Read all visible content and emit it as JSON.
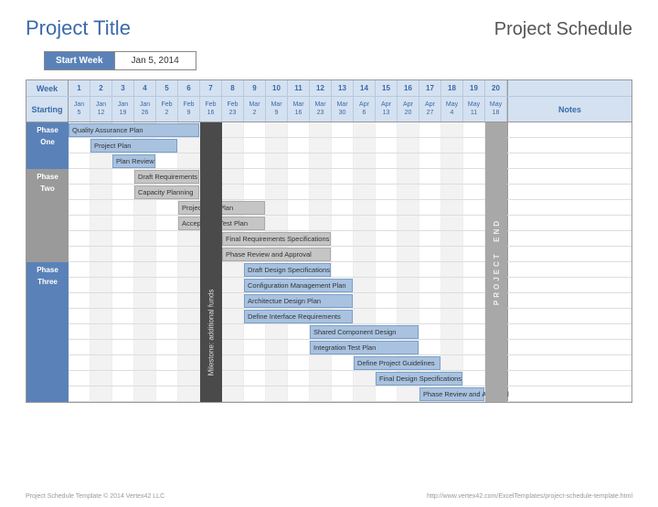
{
  "header": {
    "title": "Project Title",
    "schedule_label": "Project Schedule"
  },
  "start_week": {
    "label": "Start Week",
    "value": "Jan 5, 2014"
  },
  "columns": {
    "week_label": "Week",
    "starting_label": "Starting",
    "notes_label": "Notes",
    "weeks": [
      "1",
      "2",
      "3",
      "4",
      "5",
      "6",
      "7",
      "8",
      "9",
      "10",
      "11",
      "12",
      "13",
      "14",
      "15",
      "16",
      "17",
      "18",
      "19",
      "20"
    ],
    "dates": [
      [
        "Jan",
        "5"
      ],
      [
        "Jan",
        "12"
      ],
      [
        "Jan",
        "19"
      ],
      [
        "Jan",
        "26"
      ],
      [
        "Feb",
        "2"
      ],
      [
        "Feb",
        "9"
      ],
      [
        "Feb",
        "16"
      ],
      [
        "Feb",
        "23"
      ],
      [
        "Mar",
        "2"
      ],
      [
        "Mar",
        "9"
      ],
      [
        "Mar",
        "16"
      ],
      [
        "Mar",
        "23"
      ],
      [
        "Mar",
        "30"
      ],
      [
        "Apr",
        "6"
      ],
      [
        "Apr",
        "13"
      ],
      [
        "Apr",
        "20"
      ],
      [
        "Apr",
        "27"
      ],
      [
        "May",
        "4"
      ],
      [
        "May",
        "11"
      ],
      [
        "May",
        "18"
      ]
    ]
  },
  "phases": [
    {
      "name": "Phase One",
      "rows": [
        0,
        1,
        2
      ],
      "color": "#5a82b8"
    },
    {
      "name": "Phase Two",
      "rows": [
        3,
        4,
        5,
        6,
        7,
        8
      ],
      "color": "#9a9a9a"
    },
    {
      "name": "Phase Three",
      "rows": [
        9,
        10,
        11,
        12,
        13,
        14,
        15,
        16,
        17
      ],
      "color": "#5a82b8"
    }
  ],
  "milestone": {
    "column": 7,
    "label": "Milestone: additional funds",
    "from_row": 9,
    "to_row": 18
  },
  "project_end": {
    "column": 20,
    "label": "PROJECT END"
  },
  "chart_data": {
    "type": "gantt",
    "title": "Project Schedule",
    "x_unit": "week",
    "x_range": [
      1,
      20
    ],
    "tasks": [
      {
        "row": 0,
        "label": "Quality Assurance Plan",
        "start": 1,
        "duration": 6,
        "style": "blue"
      },
      {
        "row": 1,
        "label": "Project Plan",
        "start": 2,
        "duration": 4,
        "style": "blue"
      },
      {
        "row": 2,
        "label": "Plan Review",
        "start": 3,
        "duration": 2,
        "style": "blue"
      },
      {
        "row": 3,
        "label": "Draft Requirements",
        "start": 4,
        "duration": 3,
        "style": "gray"
      },
      {
        "row": 4,
        "label": "Capacity Planning",
        "start": 4,
        "duration": 3,
        "style": "gray"
      },
      {
        "row": 5,
        "label": "Project Test Plan",
        "start": 6,
        "duration": 4,
        "style": "gray"
      },
      {
        "row": 6,
        "label": "Acceptance Test Plan",
        "start": 6,
        "duration": 4,
        "style": "gray"
      },
      {
        "row": 7,
        "label": "Final Requirements Specifications",
        "start": 8,
        "duration": 5,
        "style": "gray"
      },
      {
        "row": 8,
        "label": "Phase Review and Approval",
        "start": 8,
        "duration": 5,
        "style": "gray"
      },
      {
        "row": 9,
        "label": "Draft Design Specifications",
        "start": 9,
        "duration": 4,
        "style": "blue"
      },
      {
        "row": 10,
        "label": "Configuration Management Plan",
        "start": 9,
        "duration": 5,
        "style": "blue"
      },
      {
        "row": 11,
        "label": "Architectue Design Plan",
        "start": 9,
        "duration": 5,
        "style": "blue"
      },
      {
        "row": 12,
        "label": "Define Interface Requirements",
        "start": 9,
        "duration": 5,
        "style": "blue"
      },
      {
        "row": 13,
        "label": "Shared Component Design",
        "start": 12,
        "duration": 5,
        "style": "blue"
      },
      {
        "row": 14,
        "label": "Integration Test Plan",
        "start": 12,
        "duration": 5,
        "style": "blue"
      },
      {
        "row": 15,
        "label": "Define Project Guidelines",
        "start": 14,
        "duration": 4,
        "style": "blue"
      },
      {
        "row": 16,
        "label": "Final Design Specifications",
        "start": 15,
        "duration": 4,
        "style": "blue"
      },
      {
        "row": 17,
        "label": "Phase Review and Approval",
        "start": 17,
        "duration": 3,
        "style": "blue"
      }
    ]
  },
  "footer": {
    "left": "Project Schedule Template © 2014 Vertex42 LLC",
    "right": "http://www.vertex42.com/ExcelTemplates/project-schedule-template.html"
  }
}
